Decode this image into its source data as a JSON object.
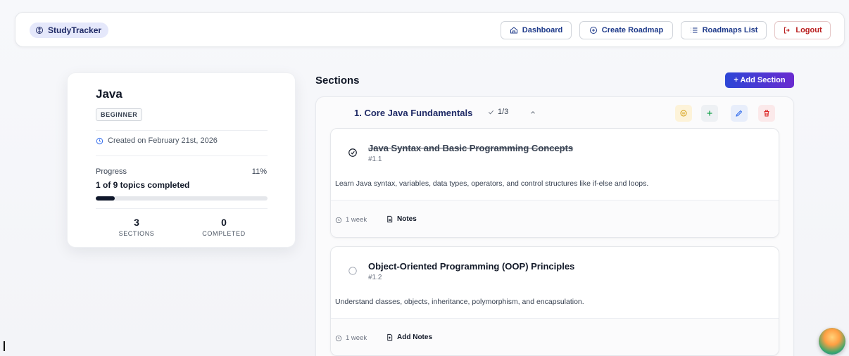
{
  "brand": {
    "name": "StudyTracker"
  },
  "nav": {
    "dashboard": "Dashboard",
    "create_roadmap": "Create Roadmap",
    "roadmaps_list": "Roadmaps List",
    "logout": "Logout"
  },
  "roadmap": {
    "title": "Java",
    "level": "BEGINNER",
    "created": "Created on February 21st, 2026",
    "progress_label": "Progress",
    "progress_percent_text": "11%",
    "progress_fraction": 0.11,
    "progress_summary": "1 of 9 topics completed",
    "stats": [
      {
        "value": "3",
        "label": "SECTIONS"
      },
      {
        "value": "0",
        "label": "COMPLETED"
      }
    ]
  },
  "sections": {
    "heading": "Sections",
    "add_label": "+ Add Section",
    "items": [
      {
        "title": "1. Core Java Fundamentals",
        "count": "1/3",
        "topics": [
          {
            "title": "Java Syntax and Basic Programming Concepts",
            "id": "#1.1",
            "completed": true,
            "description": "Learn Java syntax, variables, data types, operators, and control structures like if-else and loops.",
            "duration": "1 week",
            "notes_label": "Notes"
          },
          {
            "title": "Object-Oriented Programming (OOP) Principles",
            "id": "#1.2",
            "completed": false,
            "description": "Understand classes, objects, inheritance, polymorphism, and encapsulation.",
            "duration": "1 week",
            "notes_label": "Add Notes"
          }
        ]
      }
    ]
  },
  "colors": {
    "accent": "#2d46d6",
    "accent_end": "#6a2bd0",
    "danger": "#b91c1c",
    "brand_bg": "#e5e8fb"
  }
}
